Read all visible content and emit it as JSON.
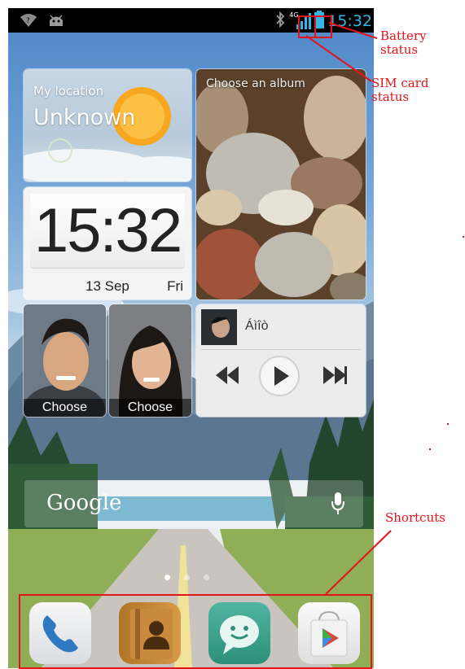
{
  "status_bar": {
    "time": "15:32",
    "network_type": "4G",
    "left_icons": [
      "wifi-question-icon",
      "android-icon"
    ],
    "right_icons": [
      "bluetooth-icon",
      "signal-4g-icon",
      "battery-icon"
    ],
    "time_color": "#33b5e5"
  },
  "weather": {
    "label": "My location",
    "value": "Unknown"
  },
  "album": {
    "label": "Choose an album"
  },
  "clock": {
    "time": "15:32",
    "date": "13 Sep",
    "day": "Fri"
  },
  "contacts": [
    {
      "label": "Choose"
    },
    {
      "label": "Choose"
    }
  ],
  "music": {
    "track": "Áìîò",
    "controls": [
      "previous-icon",
      "play-icon",
      "next-icon"
    ]
  },
  "search": {
    "label": "Google",
    "mic_icon": "microphone-icon"
  },
  "pages": {
    "count": 3,
    "active": 1
  },
  "dock": {
    "apps": [
      "phone-icon",
      "contacts-icon",
      "messaging-icon",
      "play-store-icon"
    ]
  },
  "annotations": {
    "battery": [
      "Battery",
      "status"
    ],
    "sim": [
      "SIM card",
      "status"
    ],
    "shortcuts": "Shortcuts",
    "color": "#e3141a"
  }
}
